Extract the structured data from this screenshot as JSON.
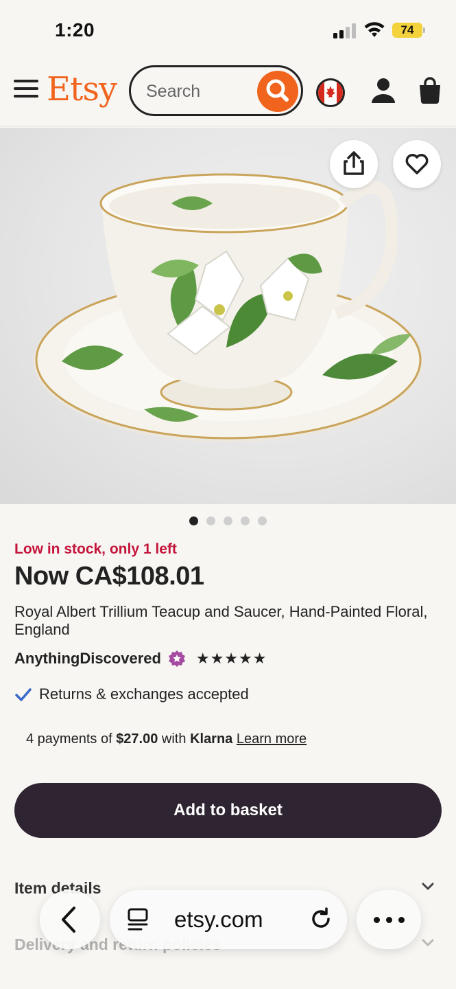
{
  "status_bar": {
    "time": "1:20",
    "battery": "74"
  },
  "header": {
    "logo": "Etsy",
    "search_placeholder": "Search",
    "icons": [
      "menu-icon",
      "search-icon",
      "canada-flag-icon",
      "account-icon",
      "shopping-bag-icon"
    ]
  },
  "colors": {
    "brand": "#f1641e",
    "stock_alert": "#c4143a",
    "button_dark": "#2f2532",
    "star_seller": "#a54ba1"
  },
  "carousel": {
    "total": 5,
    "active_index": 0
  },
  "product": {
    "stock_text": "Low in stock, only 1 left",
    "price": "Now CA$108.01",
    "title": "Royal Albert Trillium Teacup and Saucer, Hand-Painted Floral, England",
    "shop_name": "AnythingDiscovered",
    "rating_stars": "★★★★★",
    "rating_value": 5,
    "returns": "Returns & exchanges accepted",
    "klarna": {
      "prefix": "4 payments of",
      "amount": "$27.00",
      "with": "with",
      "provider": "Klarna",
      "learn_more": "Learn more"
    },
    "add_to_basket": "Add to basket"
  },
  "accordions": [
    {
      "label": "Item details"
    },
    {
      "label": "Delivery and return policies"
    }
  ],
  "browser": {
    "url": "etsy.com"
  }
}
